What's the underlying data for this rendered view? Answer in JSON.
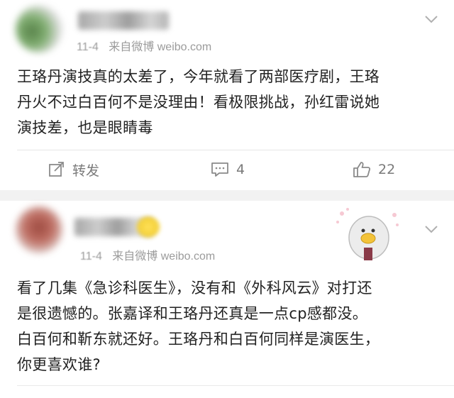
{
  "posts": [
    {
      "date": "11-4",
      "source": "来自微博 weibo.com",
      "text_lines": [
        "王珞丹演技真的太差了，今年就看了两部医疗剧，王珞",
        "丹火不过白百何不是没理由！看极限挑战，孙红雷说她",
        "演技差，也是眼睛毒"
      ],
      "actions": {
        "repost_label": "转发",
        "comment_count": "4",
        "like_count": "22"
      }
    },
    {
      "date": "11-4",
      "source": "来自微博 weibo.com",
      "text_lines": [
        "看了几集《急诊科医生》，没有和《外科风云》对打还",
        "是很遗憾的。张嘉译和王珞丹还真是一点cp感都没。",
        "白百何和靳东就还好。王珞丹和白百何同样是演医生，",
        "你更喜欢谁?"
      ]
    }
  ],
  "icons": {
    "menu": "chevron-down-icon",
    "repost": "repost-icon",
    "comment": "comment-icon",
    "like": "thumbs-up-icon"
  },
  "colors": {
    "text": "#222222",
    "meta": "#9b9b9b",
    "separator": "#f2f2f2"
  }
}
